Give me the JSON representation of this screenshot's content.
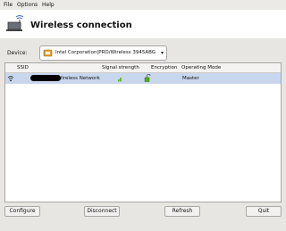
{
  "menu": {
    "file": "File",
    "options": "Options",
    "help": "Help"
  },
  "header": {
    "title": "Wireless connection"
  },
  "device": {
    "label": "Device:",
    "selected": "Intel Corporation|PRO/Wireless 3945ABG"
  },
  "table": {
    "columns": [
      "SSID",
      "Signal strength",
      "Encryption",
      "Operating Mode"
    ],
    "rows": [
      {
        "ssid_suffix": "Wireless Network",
        "mode": "Master"
      }
    ]
  },
  "buttons": {
    "configure": "Configure",
    "disconnect": "Disconnect",
    "refresh": "Refresh",
    "quit": "Quit"
  },
  "colors": {
    "selected_row": "#c9d7ee",
    "signal": "#4caf1f"
  }
}
